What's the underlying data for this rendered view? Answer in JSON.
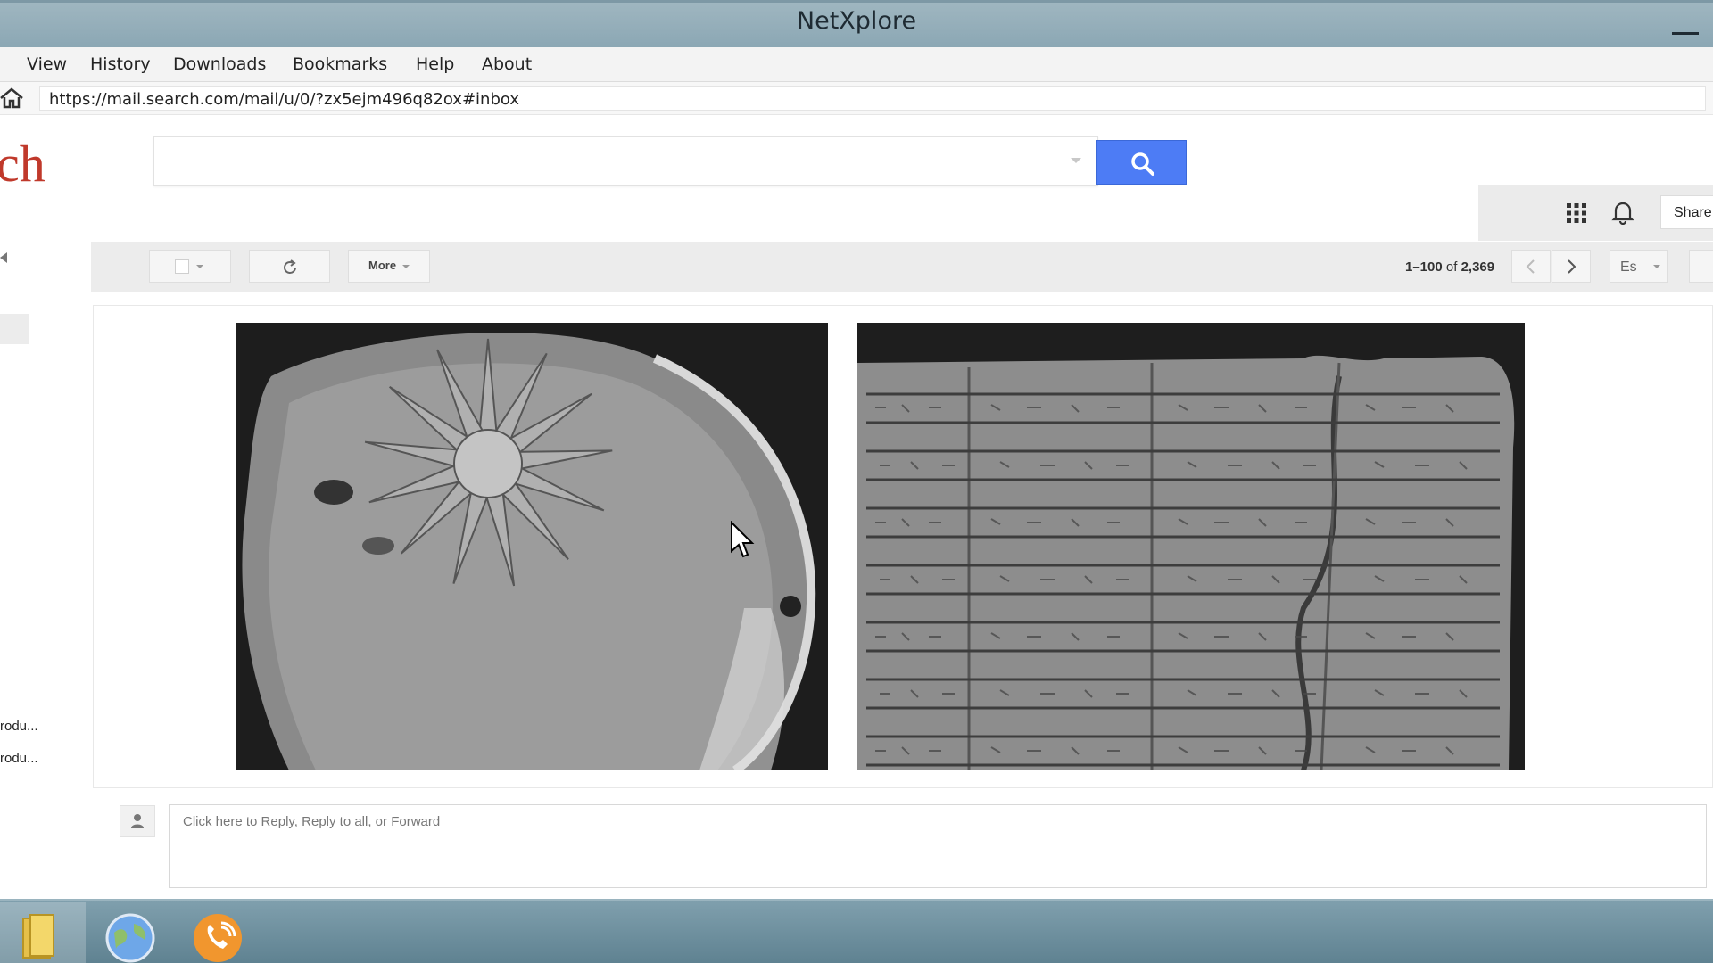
{
  "window": {
    "title": "NetXplore"
  },
  "menu": {
    "items": [
      "View",
      "History",
      "Downloads",
      "Bookmarks",
      "Help",
      "About"
    ]
  },
  "address": {
    "url": "https://mail.search.com/mail/u/0/?zx5ejm496q82ox#inbox"
  },
  "header": {
    "logo_fragment": "ch",
    "search_value": "",
    "share_label": "Share"
  },
  "toolbar": {
    "more_label": "More",
    "pager_range": "1–100",
    "pager_of": "of",
    "pager_total": "2,369",
    "input_tool_label": "Es"
  },
  "sidebar": {
    "items": [
      "rodu...",
      "rodu..."
    ]
  },
  "message": {
    "images": [
      "sun-star-relief-icon",
      "cuneiform-tablet-icon"
    ]
  },
  "reply": {
    "prefix": "Click here to ",
    "reply_link": "Reply",
    "sep1": ", ",
    "reply_all_link": "Reply to all",
    "sep2": ", or ",
    "forward_link": "Forward"
  },
  "taskbar": {
    "icons": [
      "file-explorer-icon",
      "browser-globe-icon",
      "phone-app-icon"
    ]
  },
  "colors": {
    "titlebar": "#8ba7b4",
    "search_button": "#4d7cf5",
    "logo": "#c0392b",
    "taskbar": "#6f92a1"
  }
}
